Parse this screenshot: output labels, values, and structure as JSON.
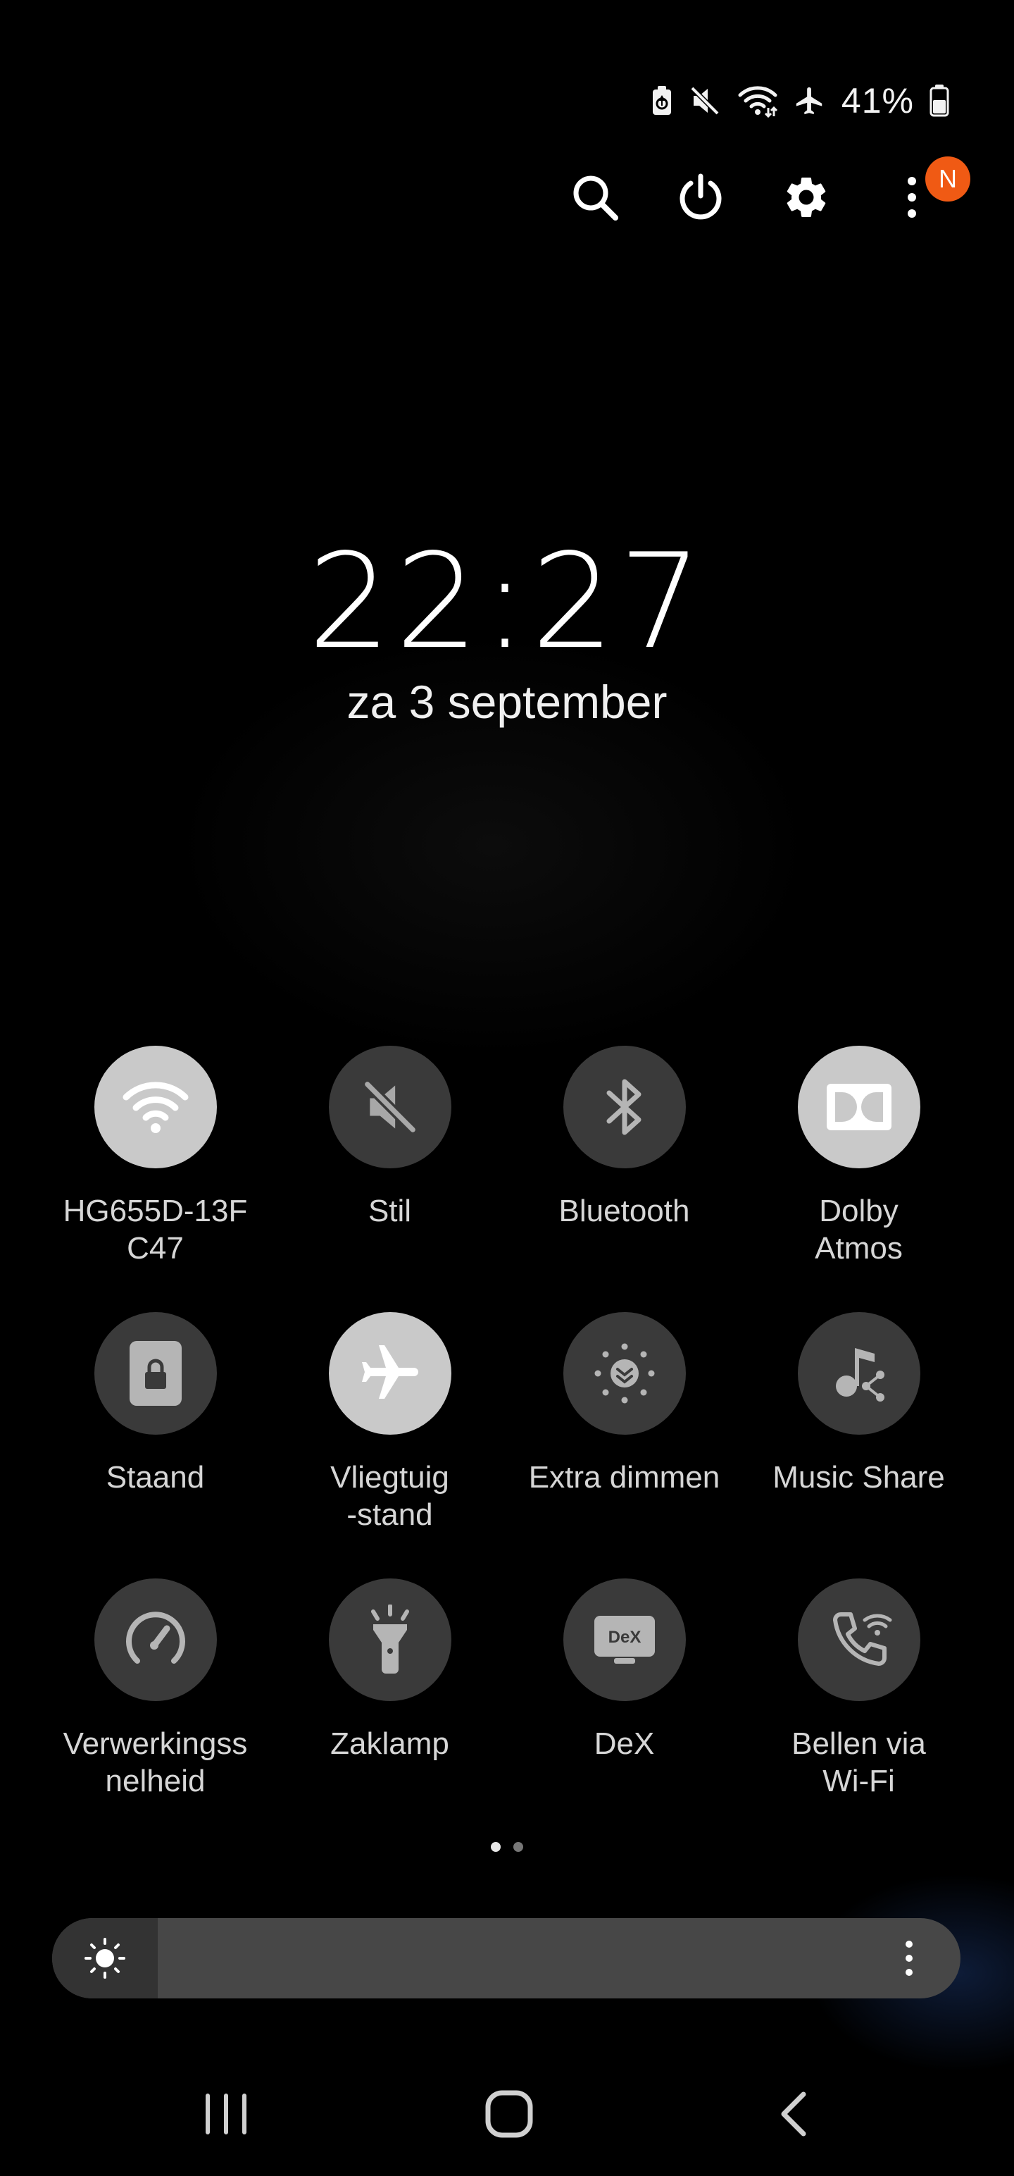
{
  "status_bar": {
    "icons": [
      "battery-saver-icon",
      "mute-icon",
      "wifi-icon",
      "airplane-icon",
      "battery-icon"
    ],
    "battery_percent": "41%"
  },
  "top_actions": {
    "icons": [
      "search-icon",
      "power-icon",
      "gear-icon",
      "more-vert-icon"
    ],
    "notification_badge": "N",
    "badge_color": "#f05a14"
  },
  "lockscreen": {
    "time": "22:27",
    "date": "za 3 september"
  },
  "quick_tiles": [
    {
      "label": "HG655D-13F\nC47",
      "icon": "wifi-icon",
      "on": true
    },
    {
      "label": "Stil",
      "icon": "mute-icon",
      "on": false
    },
    {
      "label": "Bluetooth",
      "icon": "bluetooth-icon",
      "on": false
    },
    {
      "label": "Dolby\nAtmos",
      "icon": "dolby-icon",
      "on": true
    },
    {
      "label": "Staand",
      "icon": "lock-rotation-icon",
      "on": false
    },
    {
      "label": "Vliegtuig\n-stand",
      "icon": "airplane-icon",
      "on": true
    },
    {
      "label": "Extra dimmen",
      "icon": "extra-dim-icon",
      "on": false
    },
    {
      "label": "Music Share",
      "icon": "music-share-icon",
      "on": false
    },
    {
      "label": "Verwerkingss\nnelheid",
      "icon": "speedometer-icon",
      "on": false
    },
    {
      "label": "Zaklamp",
      "icon": "flashlight-icon",
      "on": false
    },
    {
      "label": "DeX",
      "icon": "dex-icon",
      "on": false
    },
    {
      "label": "Bellen via\nWi-Fi",
      "icon": "wifi-calling-icon",
      "on": false
    }
  ],
  "dex_icon_text": "DeX",
  "pager": {
    "pages": 2,
    "current": 1
  },
  "brightness": {
    "level": 0.06
  },
  "navbar": {
    "icons": [
      "recents-icon",
      "home-icon",
      "back-icon"
    ]
  }
}
